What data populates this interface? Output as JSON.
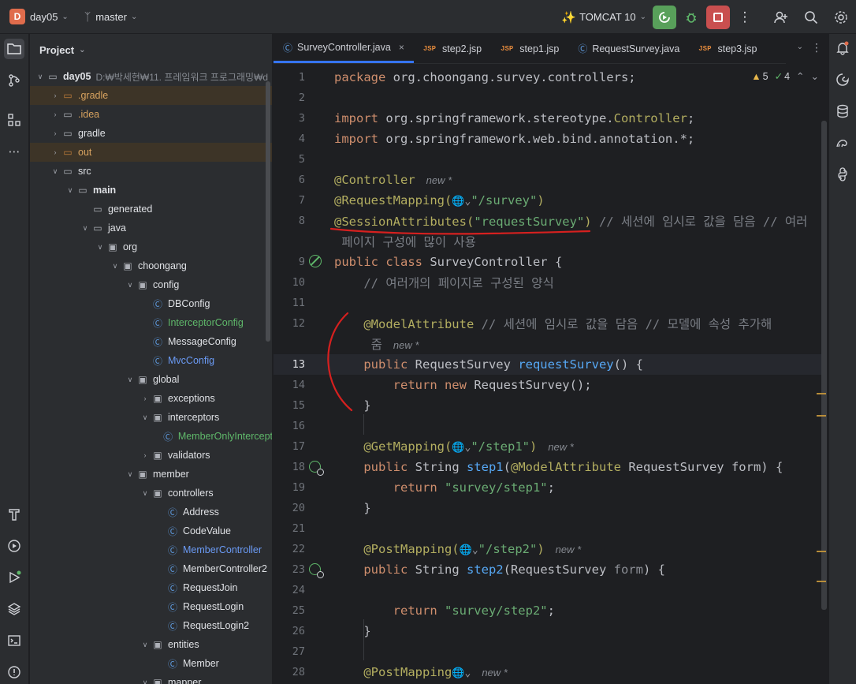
{
  "topbar": {
    "project_badge": "D",
    "project_name": "day05",
    "branch_name": "master",
    "run_config": "TOMCAT 10",
    "icons": [
      "add-user-icon",
      "search-icon",
      "gear-icon"
    ]
  },
  "project_panel": {
    "title": "Project",
    "tree": [
      {
        "label": "day05",
        "extra": "D:₩박세현₩11. 프레임워크 프로그래밍₩d",
        "indent": 0,
        "arrow": "down",
        "icon": "folder",
        "style": "bold"
      },
      {
        "label": ".gradle",
        "indent": 1,
        "arrow": "right",
        "icon": "folder-orange",
        "style": "orange",
        "hl": true
      },
      {
        "label": ".idea",
        "indent": 1,
        "arrow": "right",
        "icon": "folder",
        "style": "orange"
      },
      {
        "label": "gradle",
        "indent": 1,
        "arrow": "right",
        "icon": "folder",
        "style": ""
      },
      {
        "label": "out",
        "indent": 1,
        "arrow": "right",
        "icon": "folder-orange",
        "style": "orange",
        "hl": true
      },
      {
        "label": "src",
        "indent": 1,
        "arrow": "down",
        "icon": "folder",
        "style": ""
      },
      {
        "label": "main",
        "indent": 2,
        "arrow": "down",
        "icon": "folder",
        "style": "bold"
      },
      {
        "label": "generated",
        "indent": 3,
        "arrow": "",
        "icon": "folder",
        "style": ""
      },
      {
        "label": "java",
        "indent": 3,
        "arrow": "down",
        "icon": "folder",
        "style": ""
      },
      {
        "label": "org",
        "indent": 4,
        "arrow": "down",
        "icon": "pkg",
        "style": ""
      },
      {
        "label": "choongang",
        "indent": 5,
        "arrow": "down",
        "icon": "pkg",
        "style": ""
      },
      {
        "label": "config",
        "indent": 6,
        "arrow": "down",
        "icon": "pkg",
        "style": ""
      },
      {
        "label": "DBConfig",
        "indent": 7,
        "arrow": "",
        "icon": "cls",
        "style": ""
      },
      {
        "label": "InterceptorConfig",
        "indent": 7,
        "arrow": "",
        "icon": "cls",
        "style": "green"
      },
      {
        "label": "MessageConfig",
        "indent": 7,
        "arrow": "",
        "icon": "cls",
        "style": ""
      },
      {
        "label": "MvcConfig",
        "indent": 7,
        "arrow": "",
        "icon": "cls",
        "style": "blue"
      },
      {
        "label": "global",
        "indent": 6,
        "arrow": "down",
        "icon": "pkg",
        "style": ""
      },
      {
        "label": "exceptions",
        "indent": 7,
        "arrow": "right",
        "icon": "pkg",
        "style": ""
      },
      {
        "label": "interceptors",
        "indent": 7,
        "arrow": "down",
        "icon": "pkg",
        "style": ""
      },
      {
        "label": "MemberOnlyIntercept",
        "indent": 8,
        "arrow": "",
        "icon": "cls",
        "style": "green"
      },
      {
        "label": "validators",
        "indent": 7,
        "arrow": "right",
        "icon": "pkg",
        "style": ""
      },
      {
        "label": "member",
        "indent": 6,
        "arrow": "down",
        "icon": "pkg",
        "style": ""
      },
      {
        "label": "controllers",
        "indent": 7,
        "arrow": "down",
        "icon": "pkg",
        "style": ""
      },
      {
        "label": "Address",
        "indent": 8,
        "arrow": "",
        "icon": "cls",
        "style": ""
      },
      {
        "label": "CodeValue",
        "indent": 8,
        "arrow": "",
        "icon": "cls",
        "style": ""
      },
      {
        "label": "MemberController",
        "indent": 8,
        "arrow": "",
        "icon": "cls",
        "style": "blue"
      },
      {
        "label": "MemberController2",
        "indent": 8,
        "arrow": "",
        "icon": "cls",
        "style": ""
      },
      {
        "label": "RequestJoin",
        "indent": 8,
        "arrow": "",
        "icon": "cls",
        "style": ""
      },
      {
        "label": "RequestLogin",
        "indent": 8,
        "arrow": "",
        "icon": "cls",
        "style": ""
      },
      {
        "label": "RequestLogin2",
        "indent": 8,
        "arrow": "",
        "icon": "cls",
        "style": ""
      },
      {
        "label": "entities",
        "indent": 7,
        "arrow": "down",
        "icon": "pkg",
        "style": ""
      },
      {
        "label": "Member",
        "indent": 8,
        "arrow": "",
        "icon": "cls",
        "style": ""
      },
      {
        "label": "mapper",
        "indent": 7,
        "arrow": "down",
        "icon": "pkg",
        "style": ""
      }
    ]
  },
  "tabs": [
    {
      "label": "SurveyController.java",
      "type": "java",
      "active": true
    },
    {
      "label": "step2.jsp",
      "type": "jsp"
    },
    {
      "label": "step1.jsp",
      "type": "jsp"
    },
    {
      "label": "RequestSurvey.java",
      "type": "java"
    },
    {
      "label": "step3.jsp",
      "type": "jsp"
    }
  ],
  "inspections": {
    "warnings": "5",
    "checks": "4"
  },
  "code": {
    "l1": "package org.choongang.survey.controllers;",
    "l3a": "import ",
    "l3b": "org.springframework.stereotype.",
    "l3c": "Controller",
    "l3d": ";",
    "l4a": "import ",
    "l4b": "org.springframework.web.bind.annotation.*;",
    "l6": "@Controller",
    "hint_new": "new *",
    "l7a": "@RequestMapping(",
    "l7b": "\"/survey\"",
    "l7c": ")",
    "l8a": "@SessionAttributes(",
    "l8b": "\"requestSurvey\"",
    "l8c": ")",
    "l8cmt": " // 세션에 임시로 값을 담음 // 여러",
    "l8cont": " 페이지 구성에 많이 사용",
    "l9a": "public class ",
    "l9b": "SurveyController {",
    "l10": "    // 여러개의 페이지로 구성된 양식",
    "l12a": "    @ModelAttribute",
    "l12cmt": " // 세션에 임시로 값을 담음 // 모델에 속성 추가해",
    "l12cont": "     줌",
    "l13a": "    public ",
    "l13b": "RequestSurvey ",
    "l13c": "requestSurvey",
    "l13d": "() {",
    "l14a": "        return new ",
    "l14b": "RequestSurvey();",
    "l15": "    }",
    "l17a": "    @GetMapping(",
    "l17b": "\"/step1\"",
    "l17c": ")",
    "l18a": "    public ",
    "l18b": "String ",
    "l18c": "step1",
    "l18d": "(",
    "l18e": "@ModelAttribute",
    "l18f": " RequestSurvey form) {",
    "l19a": "        return ",
    "l19b": "\"survey/step1\"",
    "l19c": ";",
    "l20": "    }",
    "l22a": "    @PostMapping(",
    "l22b": "\"/step2\"",
    "l22c": ")",
    "l23a": "    public ",
    "l23b": "String ",
    "l23c": "step2",
    "l23d": "(RequestSurvey ",
    "l23e": "form",
    "l23f": ") {",
    "l25a": "        return ",
    "l25b": "\"survey/step2\"",
    "l25c": ";",
    "l26": "    }",
    "l28": "    @PostMapping"
  },
  "line_numbers": [
    "1",
    "2",
    "3",
    "4",
    "5",
    "6",
    "7",
    "8",
    "9",
    "10",
    "11",
    "12",
    "13",
    "14",
    "15",
    "16",
    "17",
    "18",
    "19",
    "20",
    "21",
    "22",
    "23",
    "24",
    "25",
    "26",
    "27",
    "28"
  ]
}
